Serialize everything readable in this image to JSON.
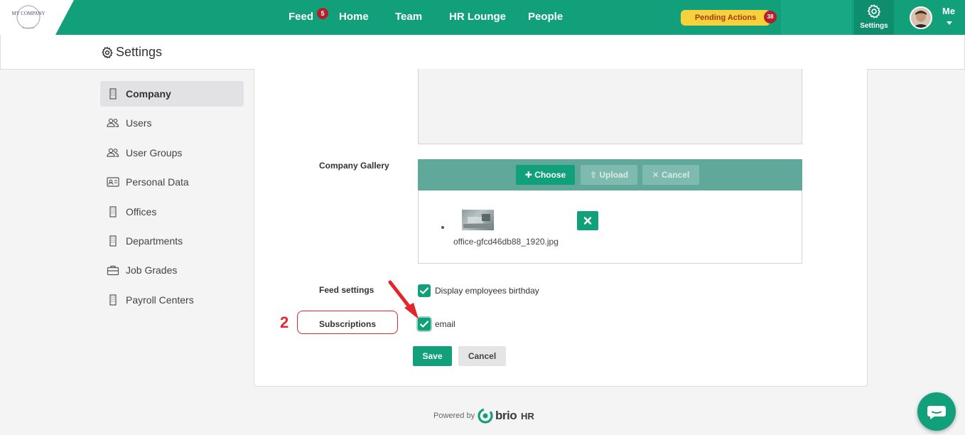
{
  "topnav": {
    "logo_text": "MY COMPANY",
    "logo_sub": "My Company",
    "links": [
      {
        "id": "feed",
        "label": "Feed",
        "badge": "5"
      },
      {
        "id": "home",
        "label": "Home"
      },
      {
        "id": "team",
        "label": "Team"
      },
      {
        "id": "hr-lounge",
        "label": "HR Lounge"
      },
      {
        "id": "people",
        "label": "People"
      }
    ],
    "pending_actions": {
      "label": "Pending Actions",
      "badge": "38"
    },
    "settings_label": "Settings",
    "me_label": "Me",
    "colors": {
      "bar": "#11a07a",
      "badge": "#b41f2b",
      "pending": "#f7d13b"
    }
  },
  "page_header": {
    "title": "Settings",
    "icon": "gear-icon"
  },
  "sidebar": {
    "items": [
      {
        "label": "Company",
        "icon": "building-icon",
        "active": true
      },
      {
        "label": "Users",
        "icon": "users-icon"
      },
      {
        "label": "User Groups",
        "icon": "users-icon"
      },
      {
        "label": "Personal Data",
        "icon": "id-card-icon"
      },
      {
        "label": "Offices",
        "icon": "building-icon"
      },
      {
        "label": "Departments",
        "icon": "building-icon"
      },
      {
        "label": "Job Grades",
        "icon": "briefcase-icon"
      },
      {
        "label": "Payroll Centers",
        "icon": "building-icon"
      }
    ]
  },
  "form": {
    "company_gallery": {
      "label": "Company Gallery",
      "choose_label": "Choose",
      "upload_label": "Upload",
      "cancel_label": "Cancel",
      "files": [
        {
          "name": "office-gfcd46db88_1920.jpg"
        }
      ]
    },
    "feed_settings": {
      "label": "Feed settings",
      "option_label": "Display employees birthday",
      "checked": true
    },
    "subscriptions": {
      "label": "Subscriptions",
      "option_label": "email",
      "checked": true
    },
    "save_label": "Save",
    "cancel_label": "Cancel"
  },
  "annotation": {
    "step_number": "2",
    "color": "#e2262a"
  },
  "footer": {
    "powered_by": "Powered by",
    "brand": "brio",
    "brand_suffix": "HR"
  }
}
